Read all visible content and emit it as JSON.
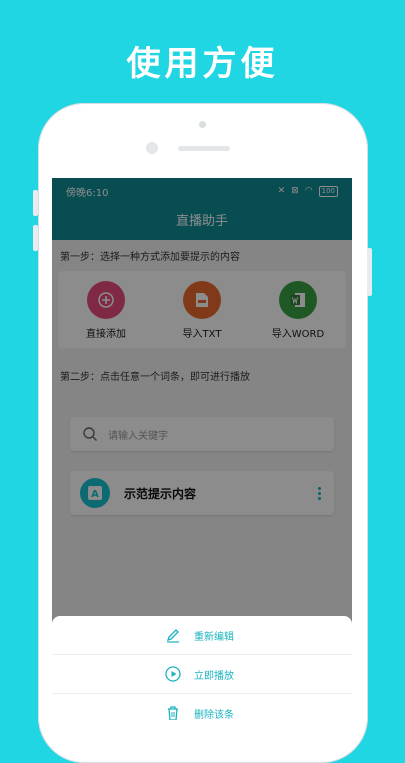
{
  "headline": "使用方便",
  "status": {
    "time": "傍晚6:10",
    "battery": "100"
  },
  "appbar": {
    "title": "直播助手"
  },
  "step1": {
    "text": "第一步：选择一种方式添加要提示的内容",
    "options": [
      {
        "label": "直接添加",
        "icon": "add-icon",
        "color": "#e94b7e"
      },
      {
        "label": "导入TXT",
        "icon": "txt-file-icon",
        "color": "#ec6a2e"
      },
      {
        "label": "导入WORD",
        "icon": "word-file-icon",
        "color": "#3aa142"
      }
    ]
  },
  "step2": {
    "text": "第二步：点击任意一个词条，即可进行播放"
  },
  "search": {
    "placeholder": "请输入关键字"
  },
  "items": [
    {
      "title": "示范提示内容",
      "icon": "text-doc-icon"
    }
  ],
  "sheet": {
    "items": [
      {
        "label": "重新编辑",
        "icon": "edit-icon"
      },
      {
        "label": "立即播放",
        "icon": "play-icon"
      },
      {
        "label": "删除该条",
        "icon": "trash-icon"
      }
    ]
  },
  "colors": {
    "background": "#1fd6e2",
    "primary": "#0f8d96",
    "accent": "#16c3cf"
  }
}
